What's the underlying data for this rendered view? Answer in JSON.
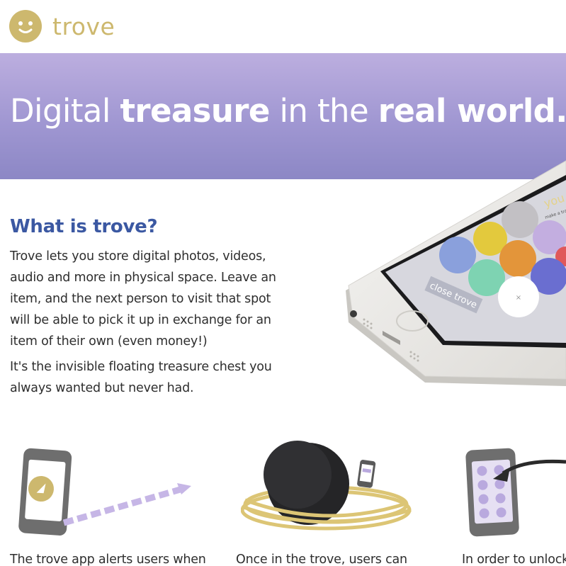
{
  "brand": {
    "name": "trove",
    "logo_icon": "smiley-face-icon",
    "color": "#cdb86e"
  },
  "hero": {
    "title_light_1": "Digital ",
    "title_bold_1": "treasure",
    "title_light_2": " in the ",
    "title_bold_2": "real world.",
    "colors": {
      "top": "#bcaedf",
      "bottom": "#8c87c5"
    }
  },
  "intro": {
    "heading": "What is trove?",
    "paragraph_1": "Trove lets you store digital photos, videos, audio and more in physical space. Leave an item, and the next person to visit that spot will be able to pick it up in exchange for an item of their own (even money!)",
    "paragraph_2": "It's the invisible floating treasure chest you always wanted but never had."
  },
  "phone_screen": {
    "close_button": "close trove",
    "cancel_symbol": "×",
    "heading_fragment": "you",
    "subheading_fragment": "make a trade"
  },
  "steps": [
    {
      "text": "The trove app alerts users when",
      "icon": "phone-alert-icon"
    },
    {
      "text": "Once in the trove, users can",
      "icon": "floating-trove-orb-icon"
    },
    {
      "text": "In order to unlock",
      "icon": "phone-unlock-icon"
    }
  ]
}
